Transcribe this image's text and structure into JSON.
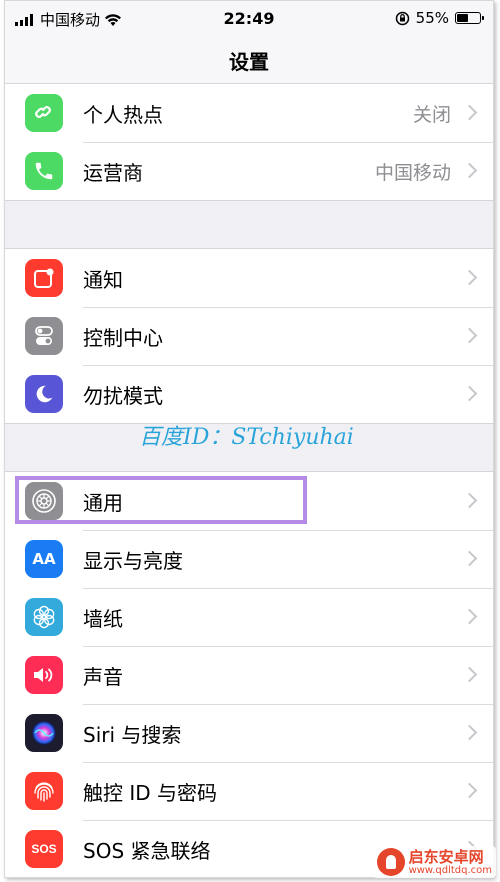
{
  "status_bar": {
    "carrier": "中国移动",
    "time": "22:49",
    "battery": "55%",
    "battery_level": 0.55
  },
  "navbar": {
    "title": "设置"
  },
  "groups": [
    {
      "items": [
        {
          "label": "个人热点",
          "value": "关闭",
          "icon": "hotspot-icon",
          "color": "#4cd964"
        },
        {
          "label": "运营商",
          "value": "中国移动",
          "icon": "phone-icon",
          "color": "#4cd964"
        }
      ]
    },
    {
      "items": [
        {
          "label": "通知",
          "icon": "notification-icon",
          "color": "#ff3b30"
        },
        {
          "label": "控制中心",
          "icon": "toggle-icon",
          "color": "#8e8e93"
        },
        {
          "label": "勿扰模式",
          "icon": "moon-icon",
          "color": "#5856d6"
        }
      ]
    },
    {
      "items": [
        {
          "label": "通用",
          "icon": "gear-icon",
          "color": "#8e8e93"
        },
        {
          "label": "显示与亮度",
          "icon": "text-size-icon",
          "color": "#1a7cf2",
          "glyph": "AA"
        },
        {
          "label": "墙纸",
          "icon": "flower-icon",
          "color": "#34aadc"
        },
        {
          "label": "声音",
          "icon": "speaker-icon",
          "color": "#ff2d55"
        },
        {
          "label": "Siri 与搜索",
          "icon": "siri-icon",
          "color": "#1c1c2e"
        },
        {
          "label": "触控 ID 与密码",
          "icon": "fingerprint-icon",
          "color": "#ff3b30"
        },
        {
          "label": "SOS 紧急联络",
          "icon": "sos-icon",
          "color": "#ff3b30",
          "glyph": "SOS"
        }
      ]
    }
  ],
  "watermarks": {
    "baidu_id": "百度ID：STchiyuhai",
    "site_name": "启东安卓网",
    "site_url": "www.qdltdq.com"
  }
}
